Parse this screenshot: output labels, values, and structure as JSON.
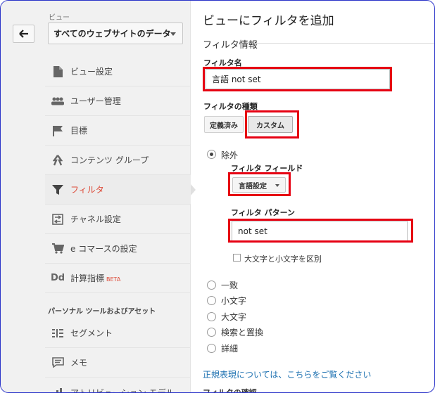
{
  "sidebar": {
    "view_label": "ビュー",
    "view_select_value": "すべてのウェブサイトのデータ",
    "items": [
      {
        "label": "ビュー設定",
        "icon": "document-icon"
      },
      {
        "label": "ユーザー管理",
        "icon": "users-icon"
      },
      {
        "label": "目標",
        "icon": "flag-icon"
      },
      {
        "label": "コンテンツ グループ",
        "icon": "content-group-icon"
      },
      {
        "label": "フィルタ",
        "icon": "filter-icon",
        "active": true
      },
      {
        "label": "チャネル設定",
        "icon": "channel-icon"
      },
      {
        "label": "e コマースの設定",
        "icon": "cart-icon"
      },
      {
        "label": "計算指標",
        "icon": "dd-icon",
        "badge": "BETA"
      }
    ],
    "section_title": "パーソナル ツールおよびアセット",
    "personal_items": [
      {
        "label": "セグメント",
        "icon": "segment-icon"
      },
      {
        "label": "メモ",
        "icon": "memo-icon"
      },
      {
        "label": "アトリビューション モデル",
        "icon": "attribution-icon"
      }
    ]
  },
  "main": {
    "title": "ビューにフィルタを追加",
    "section_title": "フィルタ情報",
    "filter_name_label": "フィルタ名",
    "filter_name_value": "言語 not set",
    "filter_type_label": "フィルタの種類",
    "type_buttons": [
      "定義済み",
      "カスタム"
    ],
    "selected_type": "カスタム",
    "exclude_label": "除外",
    "filter_field_label": "フィルタ フィールド",
    "filter_field_value": "言語設定",
    "filter_pattern_label": "フィルタ パターン",
    "filter_pattern_value": "not set",
    "case_sensitive_label": "大文字と小文字を区別",
    "other_options": [
      "一致",
      "小文字",
      "大文字",
      "検索と置換",
      "詳細"
    ],
    "regex_link": "正規表現については、こちらをご覧ください",
    "verify_label": "フィルタの確認"
  },
  "colors": {
    "highlight_box": "#e60012",
    "active_nav": "#dd4b39",
    "link": "#1a6fb0"
  }
}
